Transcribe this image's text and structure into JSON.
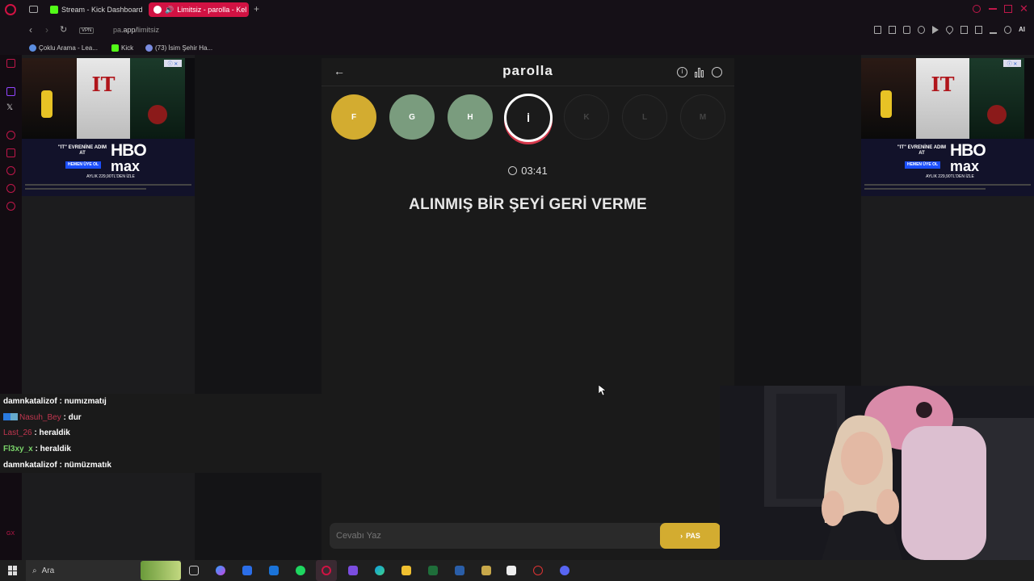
{
  "browser": {
    "tabs": [
      {
        "label": "Stream - Kick Dashboard",
        "icon": "kick-icon",
        "color": "#53fc18"
      },
      {
        "label": "Limitsiz - parolla - Kel",
        "icon": "parolla-icon",
        "color": "#d11243"
      }
    ],
    "address": {
      "prefix": "pa",
      "domain": ".app/",
      "path": "limitsiz"
    },
    "bookmarks": [
      {
        "label": "Çoklu Arama - Lea...",
        "icon": "globe-icon"
      },
      {
        "label": "Kick",
        "icon": "kick-icon"
      },
      {
        "label": "(73) İsim Şehir Ha...",
        "icon": "discord-icon"
      }
    ],
    "accent_color": "#d11243"
  },
  "ads": {
    "left": {
      "tagline": "\"IT\" EVRENİNE ADIM AT",
      "button": "HEMEN ÜYE OL",
      "brand_top": "HBO",
      "brand_bottom": "max",
      "price": "AYLIK 229,90TL'DEN İZLE",
      "poster_title": "IT"
    },
    "right": {
      "tagline": "\"IT\" EVRENİNE ADIM AT",
      "button": "HEMEN ÜYE OL",
      "brand_top": "HBO",
      "brand_bottom": "max",
      "price": "AYLIK 229,90TL'DEN İZLE",
      "poster_title": "IT"
    }
  },
  "game": {
    "title": "parolla",
    "letters": [
      {
        "char": "F",
        "state": "yellow"
      },
      {
        "char": "G",
        "state": "green"
      },
      {
        "char": "H",
        "state": "green"
      },
      {
        "char": "İ",
        "state": "active"
      },
      {
        "char": "K",
        "state": "pending"
      },
      {
        "char": "L",
        "state": "pending"
      },
      {
        "char": "M",
        "state": "pending"
      }
    ],
    "timer": "03:41",
    "question": "ALINMIŞ BİR ŞEYİ GERİ VERME",
    "answer_placeholder": "Cevabı Yaz",
    "pass_label": "PAS",
    "colors": {
      "yellow": "#d3ac30",
      "green": "#7a9c7e",
      "active_ring": "#d6394c"
    }
  },
  "chat": [
    {
      "user": "damnkatalizof",
      "message": "numızmatıj",
      "user_color": "#ffffff"
    },
    {
      "user": "Nasuh_Bey",
      "message": "dur",
      "user_color": "#c0364f"
    },
    {
      "user": "Last_26",
      "message": "heraldik",
      "user_color": "#c0364f"
    },
    {
      "user": "Fl3xy_x",
      "message": "heraldik",
      "user_color": "#7ad46a"
    },
    {
      "user": "damnkatalizof",
      "message": "nümüzmatık",
      "user_color": "#ffffff"
    }
  ],
  "taskbar": {
    "search_placeholder": "Ara"
  }
}
